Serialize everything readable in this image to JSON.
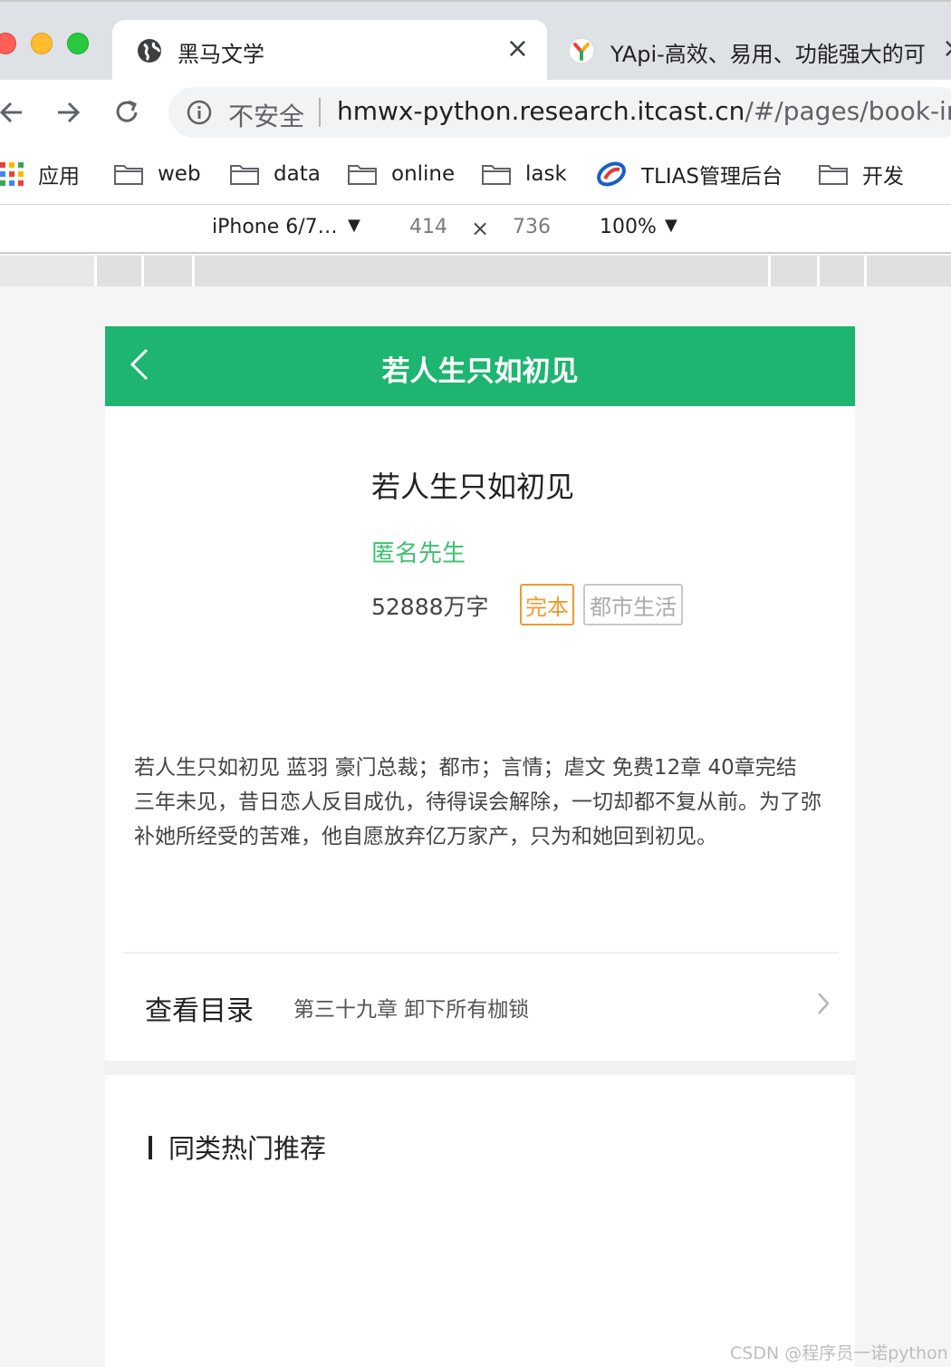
{
  "browser": {
    "tabs": [
      {
        "title": "黑马文学",
        "active": true
      },
      {
        "title": "YApi-高效、易用、功能强大的可",
        "active": false
      }
    ],
    "address": {
      "security_label": "不安全",
      "url_host": "hmwx-python.research.itcast.cn",
      "url_path": "/#/pages/book-info"
    },
    "bookmarks": [
      {
        "label": "应用",
        "icon": "apps-grid-icon"
      },
      {
        "label": "web",
        "icon": "folder-icon"
      },
      {
        "label": "data",
        "icon": "folder-icon"
      },
      {
        "label": "online",
        "icon": "folder-icon"
      },
      {
        "label": "lask",
        "icon": "folder-icon"
      },
      {
        "label": "TLIAS管理后台",
        "icon": "tlias-logo-icon"
      },
      {
        "label": "开发",
        "icon": "folder-icon"
      }
    ]
  },
  "devtools": {
    "device": "iPhone 6/7…",
    "width": "414",
    "times": "×",
    "height": "736",
    "zoom": "100%"
  },
  "page": {
    "header_title": "若人生只如初见",
    "book": {
      "title": "若人生只如初见",
      "author": "匿名先生",
      "word_count": "52888万字",
      "status_tag": "完本",
      "category_tag": "都市生活"
    },
    "intro_lines": [
      "若人生只如初见 蓝羽 豪门总裁；都市；言情；虐文 免费12章 40章完结",
      "三年未见，昔日恋人反目成仇，待得误会解除，一切却都不复从前。为了弥补她所经受的苦难，他自愿放弃亿万家产，只为和她回到初见。"
    ],
    "catalog": {
      "label": "查看目录",
      "latest_chapter": "第三十九章 卸下所有枷锁"
    },
    "recommend_title": "同类热门推荐"
  },
  "watermark": "CSDN @程序员一诺python",
  "colors": {
    "header_green": "#1db56f",
    "author_green": "#3cc26f",
    "status_orange": "#ef9a2b",
    "category_gray": "#aaaaaa"
  }
}
